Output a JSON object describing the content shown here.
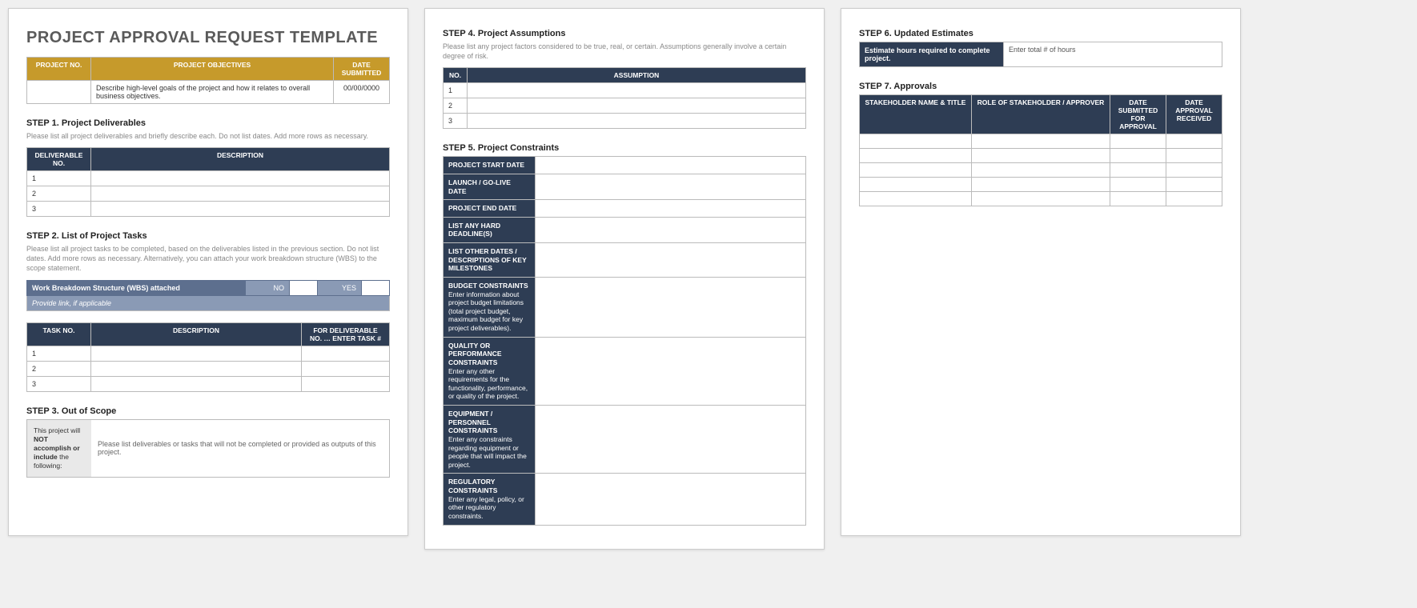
{
  "title": "PROJECT APPROVAL REQUEST TEMPLATE",
  "header_table": {
    "cols": [
      "PROJECT NO.",
      "PROJECT OBJECTIVES",
      "DATE SUBMITTED"
    ],
    "row": {
      "project_no": "",
      "objectives": "Describe high-level goals of the project and how it relates to overall business objectives.",
      "date": "00/00/0000"
    }
  },
  "step1": {
    "title": "STEP 1. Project Deliverables",
    "desc": "Please list all project deliverables and briefly describe each. Do not list dates. Add more rows as necessary.",
    "cols": [
      "DELIVERABLE NO.",
      "DESCRIPTION"
    ],
    "rows": [
      "1",
      "2",
      "3"
    ]
  },
  "step2": {
    "title": "STEP 2. List of Project Tasks",
    "desc": "Please list all project tasks to be completed, based on the deliverables listed in the previous section. Do not list dates. Add more rows as necessary. Alternatively, you can attach your work breakdown structure (WBS) to the scope statement.",
    "wbs_label": "Work Breakdown Structure (WBS) attached",
    "wbs_no": "NO",
    "wbs_yes": "YES",
    "wbs_link": "Provide link, if applicable",
    "cols": [
      "TASK NO.",
      "DESCRIPTION",
      "FOR DELIVERABLE NO. … ENTER TASK #"
    ],
    "rows": [
      "1",
      "2",
      "3"
    ]
  },
  "step3": {
    "title": "STEP 3. Out of Scope",
    "left_a": "This project will ",
    "left_b": "NOT accomplish or include",
    "left_c": " the following:",
    "right": "Please list deliverables or tasks that will not be completed or provided as outputs of this project."
  },
  "step4": {
    "title": "STEP 4. Project Assumptions",
    "desc": "Please list any project factors considered to be true, real, or certain. Assumptions generally involve a certain degree of risk.",
    "cols": [
      "NO.",
      "ASSUMPTION"
    ],
    "rows": [
      "1",
      "2",
      "3"
    ]
  },
  "step5": {
    "title": "STEP 5. Project Constraints",
    "rows": [
      {
        "label": "PROJECT START DATE",
        "sub": ""
      },
      {
        "label": "LAUNCH / GO-LIVE DATE",
        "sub": ""
      },
      {
        "label": "PROJECT END DATE",
        "sub": ""
      },
      {
        "label": "LIST ANY HARD DEADLINE(S)",
        "sub": ""
      },
      {
        "label": "LIST OTHER DATES / DESCRIPTIONS OF KEY MILESTONES",
        "sub": ""
      },
      {
        "label": "BUDGET CONSTRAINTS",
        "sub": "Enter information about project budget limitations (total project budget, maximum budget for key project deliverables)."
      },
      {
        "label": "QUALITY OR PERFORMANCE CONSTRAINTS",
        "sub": "Enter any other requirements for the functionality, performance, or quality of the project."
      },
      {
        "label": "EQUIPMENT / PERSONNEL CONSTRAINTS",
        "sub": "Enter any constraints regarding equipment or people that will impact the project."
      },
      {
        "label": "REGULATORY CONSTRAINTS",
        "sub": "Enter any legal, policy, or other regulatory constraints."
      }
    ]
  },
  "step6": {
    "title": "STEP 6. Updated Estimates",
    "label": "Estimate hours required to complete project.",
    "placeholder": "Enter total # of hours"
  },
  "step7": {
    "title": "STEP 7. Approvals",
    "cols": [
      "STAKEHOLDER NAME & TITLE",
      "ROLE OF STAKEHOLDER / APPROVER",
      "DATE SUBMITTED FOR APPROVAL",
      "DATE APPROVAL RECEIVED"
    ],
    "n_rows": 5
  }
}
